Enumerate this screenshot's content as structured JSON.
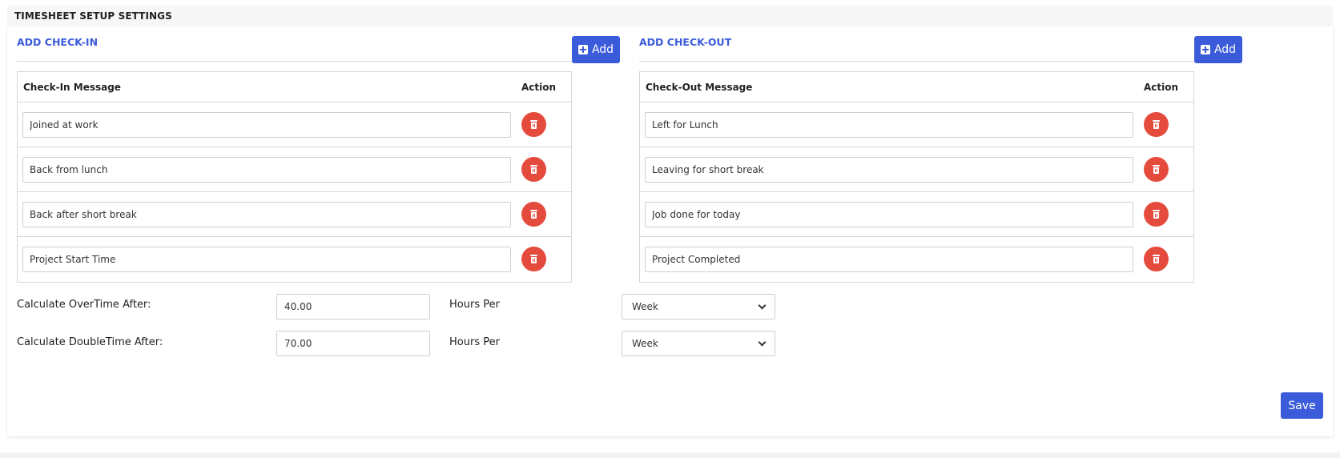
{
  "page": {
    "title": "TIMESHEET SETUP SETTINGS"
  },
  "checkin": {
    "title": "ADD CHECK-IN",
    "add_label": "Add",
    "col_message": "Check-In Message",
    "col_action": "Action",
    "rows": [
      {
        "value": "Joined at work"
      },
      {
        "value": "Back from lunch"
      },
      {
        "value": "Back after short break"
      },
      {
        "value": "Project Start Time"
      }
    ]
  },
  "checkout": {
    "title": "ADD CHECK-OUT",
    "add_label": "Add",
    "col_message": "Check-Out Message",
    "col_action": "Action",
    "rows": [
      {
        "value": "Left for Lunch"
      },
      {
        "value": "Leaving for short break"
      },
      {
        "value": "Job done for today"
      },
      {
        "value": "Project Completed"
      }
    ]
  },
  "overtime": {
    "label": "Calculate OverTime After:",
    "value": "40.00",
    "hours_label": "Hours Per",
    "period": "Week"
  },
  "doubletime": {
    "label": "Calculate DoubleTime After:",
    "value": "70.00",
    "hours_label": "Hours Per",
    "period": "Week"
  },
  "actions": {
    "save_label": "Save"
  },
  "colors": {
    "accent": "#3b5bdb",
    "danger": "#e54b3c"
  }
}
